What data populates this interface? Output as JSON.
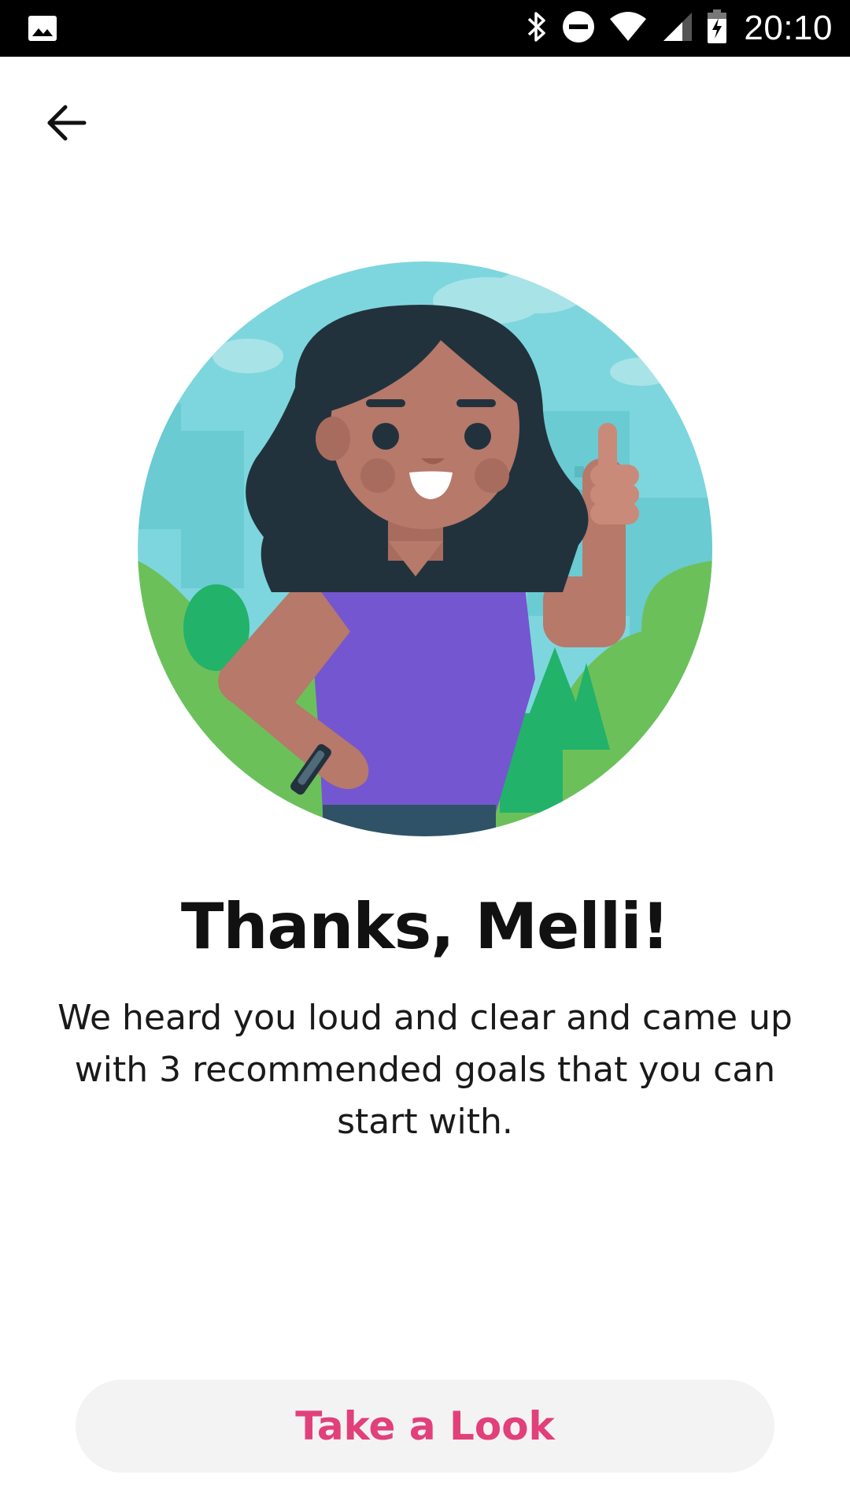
{
  "status_bar": {
    "time": "20:10",
    "icons": [
      "image-icon",
      "bluetooth-icon",
      "do-not-disturb-icon",
      "wifi-icon",
      "cellular-signal-icon",
      "battery-charging-icon"
    ]
  },
  "navigation": {
    "back_icon": "arrow-left-icon"
  },
  "illustration": {
    "description_icon": "woman-thumbs-up-illustration"
  },
  "content": {
    "title": "Thanks, Melli!",
    "message": "We heard you loud and clear and came up with 3 recommended goals that you can start with."
  },
  "actions": {
    "primary_label": "Take a Look"
  },
  "colors": {
    "status_bar_bg": "#000000",
    "accent_pink": "#e2407a",
    "button_bg": "#f3f3f3",
    "sky": "#7dd6dd",
    "grass": "#6cc05a",
    "shirt": "#7456d0",
    "hair": "#22323d",
    "skin": "#b6796a"
  }
}
